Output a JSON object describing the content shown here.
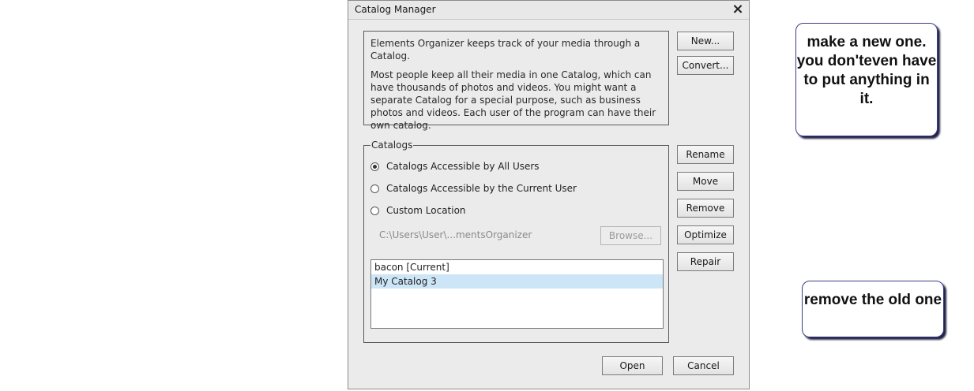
{
  "dialog": {
    "title": "Catalog Manager",
    "close_icon": "×",
    "info_paragraph_1": "Elements Organizer keeps track of your media through a Catalog.",
    "info_paragraph_2": "Most people keep all their media in one Catalog, which can have thousands of photos and videos. You might want a separate Catalog for a special purpose, such as business photos and videos. Each user of the program can have their own catalog.",
    "buttons": {
      "new": "New...",
      "convert": "Convert...",
      "rename": "Rename",
      "move": "Move",
      "remove": "Remove",
      "optimize": "Optimize",
      "repair": "Repair",
      "browse": "Browse...",
      "open": "Open",
      "cancel": "Cancel"
    },
    "catalogs_group": {
      "legend": "Catalogs",
      "options": [
        {
          "label": "Catalogs Accessible by All Users",
          "checked": true
        },
        {
          "label": "Catalogs Accessible by the Current User",
          "checked": false
        },
        {
          "label": "Custom Location",
          "checked": false
        }
      ],
      "path": "C:\\Users\\User\\...mentsOrganizer",
      "list": [
        "bacon [Current]",
        "My Catalog 3"
      ],
      "selected_index": 1
    }
  },
  "callouts": {
    "new_note": "make a new one. you don'teven have to put anything in it.",
    "remove_note": "remove the old one"
  },
  "colors": {
    "selection": "#cde6f7",
    "callout_border": "#3b3b8a",
    "dialog_bg": "#ebebeb"
  }
}
